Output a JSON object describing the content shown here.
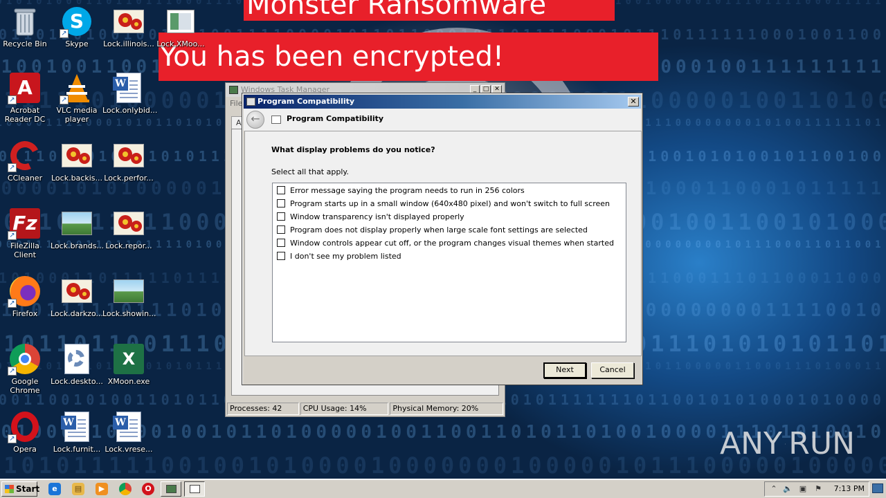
{
  "banners": {
    "title": "Monster Ransomware",
    "subtitle": "You has been encrypted!"
  },
  "desktop_icons": [
    {
      "label": "Recycle Bin",
      "icon": "recycle-bin-icon"
    },
    {
      "label": "Skype",
      "icon": "skype-icon"
    },
    {
      "label": "Lock.illinois...",
      "icon": "image-file-icon"
    },
    {
      "label": "Lock.XMoo...",
      "icon": "image-file-icon"
    },
    {
      "label": "Acrobat Reader DC",
      "icon": "acrobat-icon"
    },
    {
      "label": "VLC media player",
      "icon": "vlc-icon"
    },
    {
      "label": "Lock.onlybid...",
      "icon": "word-document-icon"
    },
    {
      "label": "CCleaner",
      "icon": "ccleaner-icon"
    },
    {
      "label": "Lock.backis...",
      "icon": "image-file-icon"
    },
    {
      "label": "Lock.perfor...",
      "icon": "image-file-icon"
    },
    {
      "label": "FileZilla Client",
      "icon": "filezilla-icon"
    },
    {
      "label": "Lock.brands...",
      "icon": "image-file-icon"
    },
    {
      "label": "Lock.repor...",
      "icon": "image-file-icon"
    },
    {
      "label": "Firefox",
      "icon": "firefox-icon"
    },
    {
      "label": "Lock.darkzo...",
      "icon": "image-file-icon"
    },
    {
      "label": "Lock.showin...",
      "icon": "image-file-icon"
    },
    {
      "label": "Google Chrome",
      "icon": "chrome-icon"
    },
    {
      "label": "Lock.deskto...",
      "icon": "settings-file-icon"
    },
    {
      "label": "XMoon.exe",
      "icon": "excel-icon"
    },
    {
      "label": "Opera",
      "icon": "opera-icon"
    },
    {
      "label": "Lock.furnit...",
      "icon": "word-document-icon"
    },
    {
      "label": "Lock.vrese...",
      "icon": "word-document-icon"
    }
  ],
  "task_manager": {
    "title": "Windows Task Manager",
    "menu_file": "File",
    "tab_label": "Ap",
    "status": {
      "processes": "Processes: 42",
      "cpu": "CPU Usage: 14%",
      "memory": "Physical Memory: 20%"
    }
  },
  "compat_dialog": {
    "title": "Program Compatibility",
    "header_title": "Program Compatibility",
    "question": "What display problems do you notice?",
    "instruction": "Select all that apply.",
    "options": [
      {
        "label": "Error message saying the program needs to run in 256 colors",
        "checked": false
      },
      {
        "label": "Program starts up in a small window (640x480 pixel) and won't switch to full screen",
        "checked": false
      },
      {
        "label": "Window transparency isn't displayed properly",
        "checked": false
      },
      {
        "label": "Program does not display properly when large scale font settings are selected",
        "checked": false
      },
      {
        "label": "Window controls appear cut off, or the program changes visual themes when started",
        "checked": false
      },
      {
        "label": "I don't see my problem listed",
        "checked": false
      }
    ],
    "next_label": "Next",
    "cancel_label": "Cancel"
  },
  "watermark": {
    "left": "ANY",
    "right": "RUN"
  },
  "taskbar": {
    "start_label": "Start",
    "clock": "7:13 PM"
  },
  "colors": {
    "banner_red": "#e8202a",
    "title_bar_blue": "#0a246a",
    "taskbar_gray": "#d4d0c8"
  }
}
